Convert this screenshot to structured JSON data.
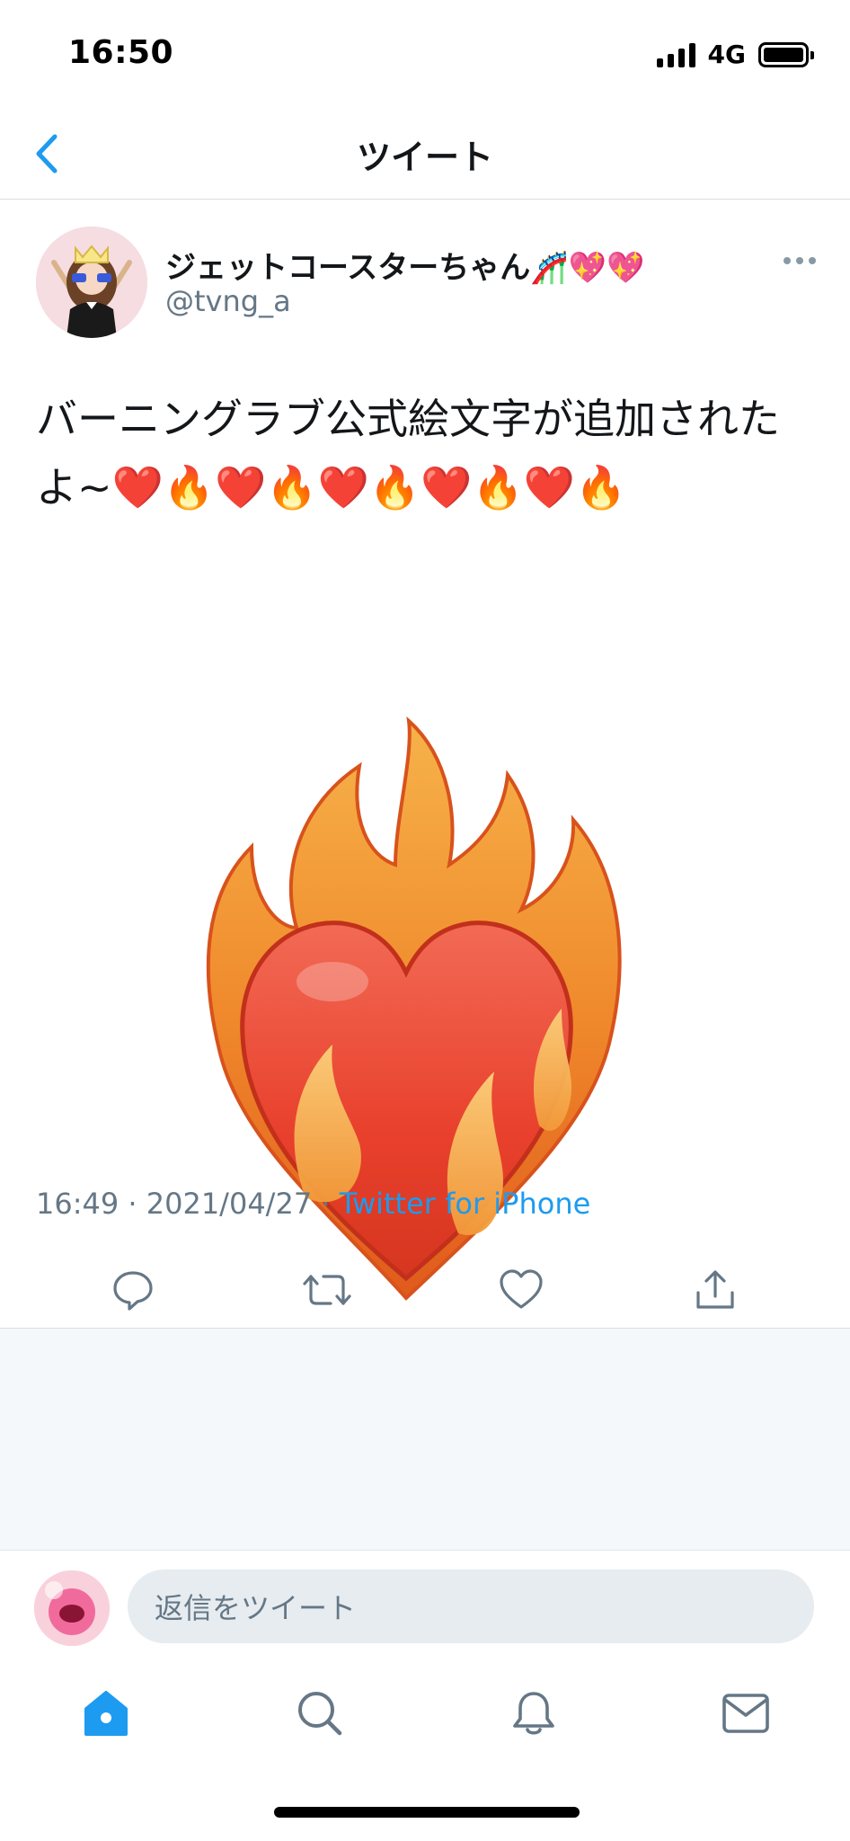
{
  "status_bar": {
    "time": "16:50",
    "network": "4G"
  },
  "header": {
    "title": "ツイート"
  },
  "tweet": {
    "user_name": "ジェットコースターちゃん🎢💖💖",
    "user_handle": "@tvng_a",
    "text": "バーニングラブ公式絵文字が追加されたよ~❤️🔥❤️🔥❤️🔥❤️🔥❤️🔥",
    "time": "16:49",
    "date": "2021/04/27",
    "separator": " · ",
    "source": "Twitter for iPhone"
  },
  "actions": [
    {
      "icon": "reply-icon"
    },
    {
      "icon": "retweet-icon"
    },
    {
      "icon": "like-icon"
    },
    {
      "icon": "share-icon"
    }
  ],
  "reply": {
    "placeholder": "返信をツイート"
  },
  "tabs": [
    {
      "icon": "home-icon",
      "active": true
    },
    {
      "icon": "search-icon",
      "active": false
    },
    {
      "icon": "notifications-icon",
      "active": false
    },
    {
      "icon": "messages-icon",
      "active": false
    }
  ],
  "colors": {
    "accent": "#1d9bf0",
    "text": "#14171a",
    "secondary": "#657786",
    "icon": "#657786"
  }
}
